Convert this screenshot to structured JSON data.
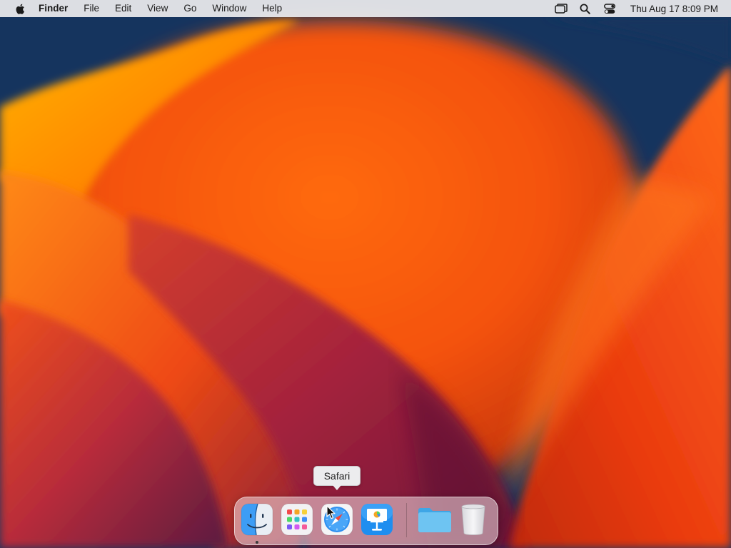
{
  "menubar": {
    "apple_icon": "apple-logo-icon",
    "app_name": "Finder",
    "items": [
      "File",
      "Edit",
      "View",
      "Go",
      "Window",
      "Help"
    ],
    "status_icons": [
      "screen-mirroring-icon",
      "search-icon",
      "control-center-icon"
    ],
    "clock": "Thu Aug 17  8:09 PM"
  },
  "tooltip": {
    "label": "Safari"
  },
  "dock": {
    "apps": [
      {
        "name": "Finder",
        "icon": "finder-icon",
        "running": true
      },
      {
        "name": "Launchpad",
        "icon": "launchpad-icon",
        "running": false
      },
      {
        "name": "Safari",
        "icon": "safari-icon",
        "running": false
      },
      {
        "name": "Keynote",
        "icon": "keynote-icon",
        "running": false
      }
    ],
    "others": [
      {
        "name": "Downloads",
        "icon": "folder-icon"
      },
      {
        "name": "Trash",
        "icon": "trash-icon"
      }
    ]
  },
  "colors": {
    "wallpaper_orange": "#ff5a0c",
    "wallpaper_navy": "#15345e",
    "wallpaper_magenta": "#8a1e3c",
    "menubar_bg": "#ececee",
    "finder_blue": "#3d9df5",
    "folder_blue": "#5ab8ee"
  }
}
